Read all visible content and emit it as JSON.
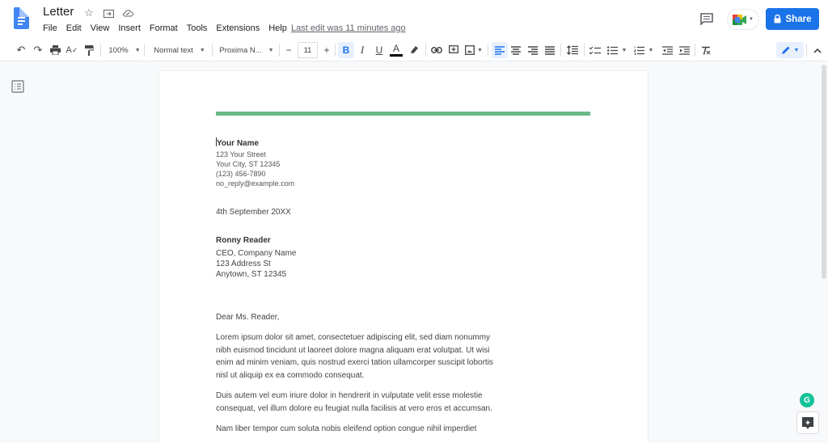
{
  "app": {
    "doc_title": "Letter",
    "title_icons": [
      "star-icon",
      "move-to-folder-icon",
      "cloud-status-icon"
    ],
    "menu": [
      "File",
      "Edit",
      "View",
      "Insert",
      "Format",
      "Tools",
      "Extensions",
      "Help"
    ],
    "last_edit": "Last edit was 11 minutes ago",
    "share_label": "Share",
    "brand_color": "#1a73e8"
  },
  "toolbar": {
    "zoom": "100%",
    "style": "Normal text",
    "font": "Proxima N...",
    "font_size": "11",
    "decrease": "−",
    "increase": "+",
    "bold": "B",
    "italic": "I",
    "underline": "U",
    "text_color": "A",
    "editing_mode_icon": "pencil-icon"
  },
  "document": {
    "rule_color": "#6aba86",
    "sender": {
      "name": "Your Name",
      "street": "123 Your Street",
      "city": "Your City, ST 12345",
      "phone": "(123) 456-7890",
      "email": "no_reply@example.com"
    },
    "date": "4th September 20XX",
    "recipient": {
      "name": "Ronny Reader",
      "title": "CEO, Company Name",
      "street": "123 Address St",
      "city": "Anytown, ST 12345"
    },
    "salutation": "Dear Ms. Reader,",
    "paragraphs": [
      [
        "Lorem ipsum dolor sit amet, consectetuer adipiscing elit, sed diam nonummy",
        "nibh euismod tincidunt ut laoreet dolore magna aliquam erat volutpat. Ut wisi",
        "enim ad minim veniam, quis nostrud exerci tation ullamcorper suscipit lobortis",
        "nisl ut aliquip ex ea commodo consequat."
      ],
      [
        "Duis autem vel eum iriure dolor in hendrerit in vulputate velit esse molestie",
        "consequat, vel illum dolore eu feugiat nulla facilisis at vero eros et accumsan."
      ],
      [
        "Nam liber tempor cum soluta nobis eleifend option congue nihil imperdiet"
      ]
    ]
  },
  "side": {
    "grammarly_label": "G"
  }
}
